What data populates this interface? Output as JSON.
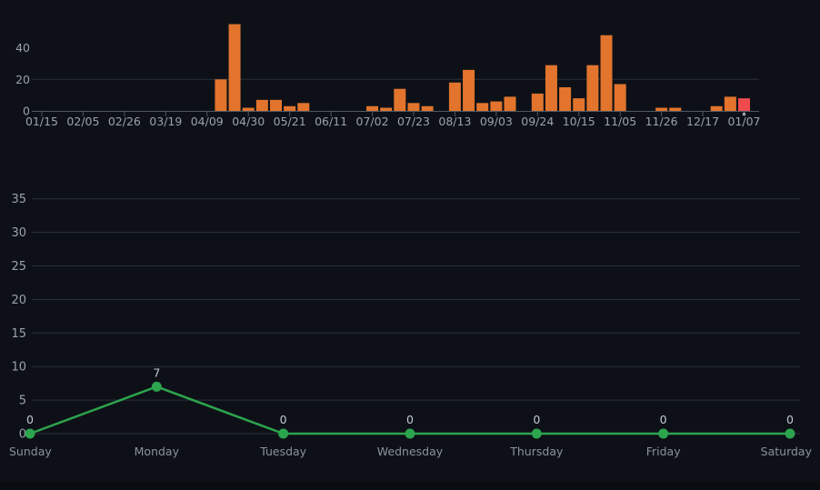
{
  "page": {
    "description": "Commit activity dashboard with weekly commits bar chart and commits-by-day-of-week line chart"
  },
  "theme": {
    "background": "#0d1117",
    "bottom_strip": "#090c10",
    "bar_color": "#e2742d",
    "bar_selected_color": "#ef4b4e",
    "line_color": "#2da44e",
    "dot_color": "#2da44e",
    "grid_color": "#2a3039",
    "axis_line_color": "#515960",
    "tick_label_color": "#9aa2aa",
    "y_label_color": "#9aa2aa",
    "value_label_color": "#c3cad2",
    "day_label_color": "#8a929b",
    "selection_marker_color": "#9aa2aa"
  },
  "chart_data": [
    {
      "id": "weekly-commits",
      "type": "bar",
      "title": "",
      "xlabel": "",
      "ylabel": "",
      "x_tick_labels": [
        "01/15",
        "02/05",
        "02/26",
        "03/19",
        "04/09",
        "04/30",
        "05/21",
        "06/11",
        "07/02",
        "07/23",
        "08/13",
        "09/03",
        "09/24",
        "10/15",
        "11/05",
        "11/26",
        "12/17",
        "01/07"
      ],
      "tick_every_n_weeks": 3,
      "values": [
        0,
        0,
        0,
        0,
        0,
        0,
        0,
        0,
        0,
        0,
        0,
        0,
        0,
        20,
        55,
        2,
        7,
        7,
        3,
        5,
        0,
        0,
        0,
        0,
        3,
        2,
        14,
        5,
        3,
        0,
        18,
        26,
        5,
        6,
        9,
        0,
        11,
        29,
        15,
        8,
        29,
        48,
        17,
        0,
        0,
        2,
        2,
        0,
        0,
        3,
        9,
        8
      ],
      "selected_index": 51,
      "yticks": [
        0,
        20,
        40
      ],
      "gridline_values": [
        20
      ],
      "ylim": [
        0,
        58
      ],
      "legend": "none",
      "notes": "selected week drawn in red with a small marker dot under the axis"
    },
    {
      "id": "commits-by-day-of-week",
      "type": "line",
      "title": "",
      "xlabel": "",
      "ylabel": "",
      "categories": [
        "Sunday",
        "Monday",
        "Tuesday",
        "Wednesday",
        "Thursday",
        "Friday",
        "Saturday"
      ],
      "values": [
        0,
        7,
        0,
        0,
        0,
        0,
        0
      ],
      "point_labels": [
        "0",
        "7",
        "0",
        "0",
        "0",
        "0",
        "0"
      ],
      "yticks": [
        0,
        5,
        10,
        15,
        20,
        25,
        30,
        35
      ],
      "ylim": [
        0,
        37
      ],
      "grid": "horizontal",
      "legend": "none"
    }
  ]
}
